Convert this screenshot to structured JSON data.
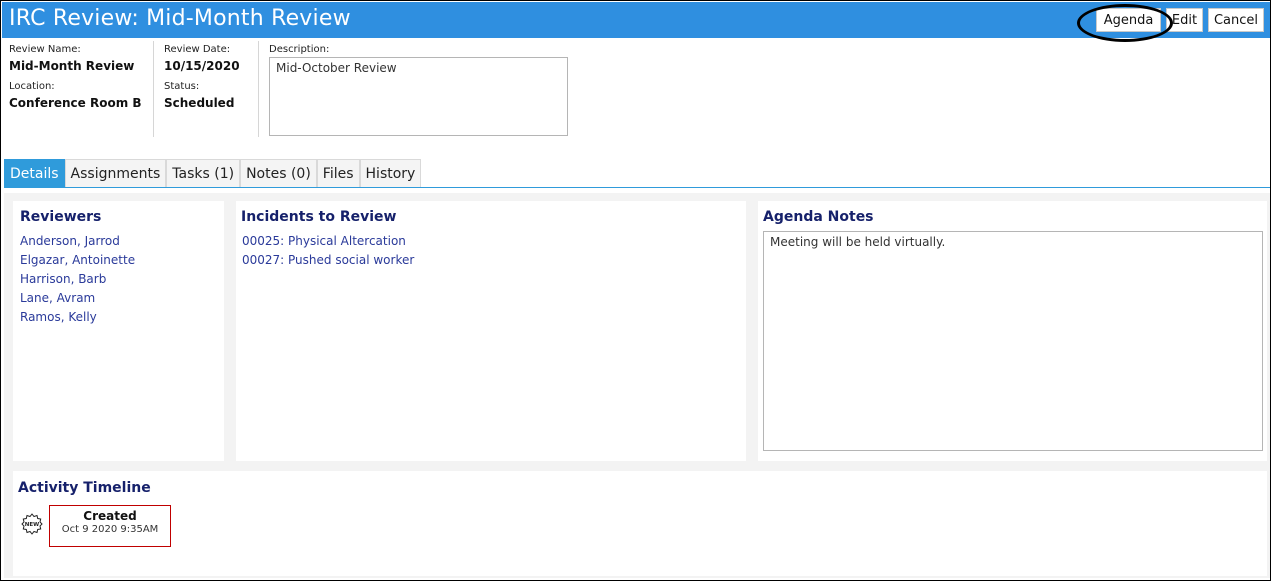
{
  "header": {
    "title": "IRC Review: Mid-Month Review",
    "buttons": {
      "agenda": "Agenda",
      "edit": "Edit",
      "cancel": "Cancel"
    }
  },
  "info": {
    "review_name_label": "Review Name:",
    "review_name": "Mid-Month Review",
    "location_label": "Location:",
    "location": "Conference Room B",
    "review_date_label": "Review Date:",
    "review_date": "10/15/2020",
    "status_label": "Status:",
    "status": "Scheduled",
    "description_label": "Description:",
    "description": "Mid-October Review"
  },
  "tabs": [
    {
      "label": "Details",
      "active": true
    },
    {
      "label": "Assignments",
      "active": false
    },
    {
      "label": "Tasks (1)",
      "active": false
    },
    {
      "label": "Notes (0)",
      "active": false
    },
    {
      "label": "Files",
      "active": false
    },
    {
      "label": "History",
      "active": false
    }
  ],
  "reviewers": {
    "title": "Reviewers",
    "items": [
      "Anderson, Jarrod",
      "Elgazar, Antoinette",
      "Harrison, Barb",
      "Lane, Avram",
      "Ramos, Kelly"
    ]
  },
  "incidents": {
    "title": "Incidents to Review",
    "items": [
      "00025: Physical Altercation",
      "00027: Pushed social worker"
    ]
  },
  "agenda_notes": {
    "title": "Agenda Notes",
    "text": "Meeting will be held virtually."
  },
  "timeline": {
    "title": "Activity Timeline",
    "icon": "new-badge-icon",
    "icon_text": "NEW",
    "event_title": "Created",
    "event_time": "Oct 9 2020 9:35AM"
  },
  "colors": {
    "header_bg": "#2f8fe0",
    "active_tab": "#2f9bdb",
    "panel_title": "#16216b",
    "link": "#2a3a9a",
    "event_border": "#c00000"
  }
}
